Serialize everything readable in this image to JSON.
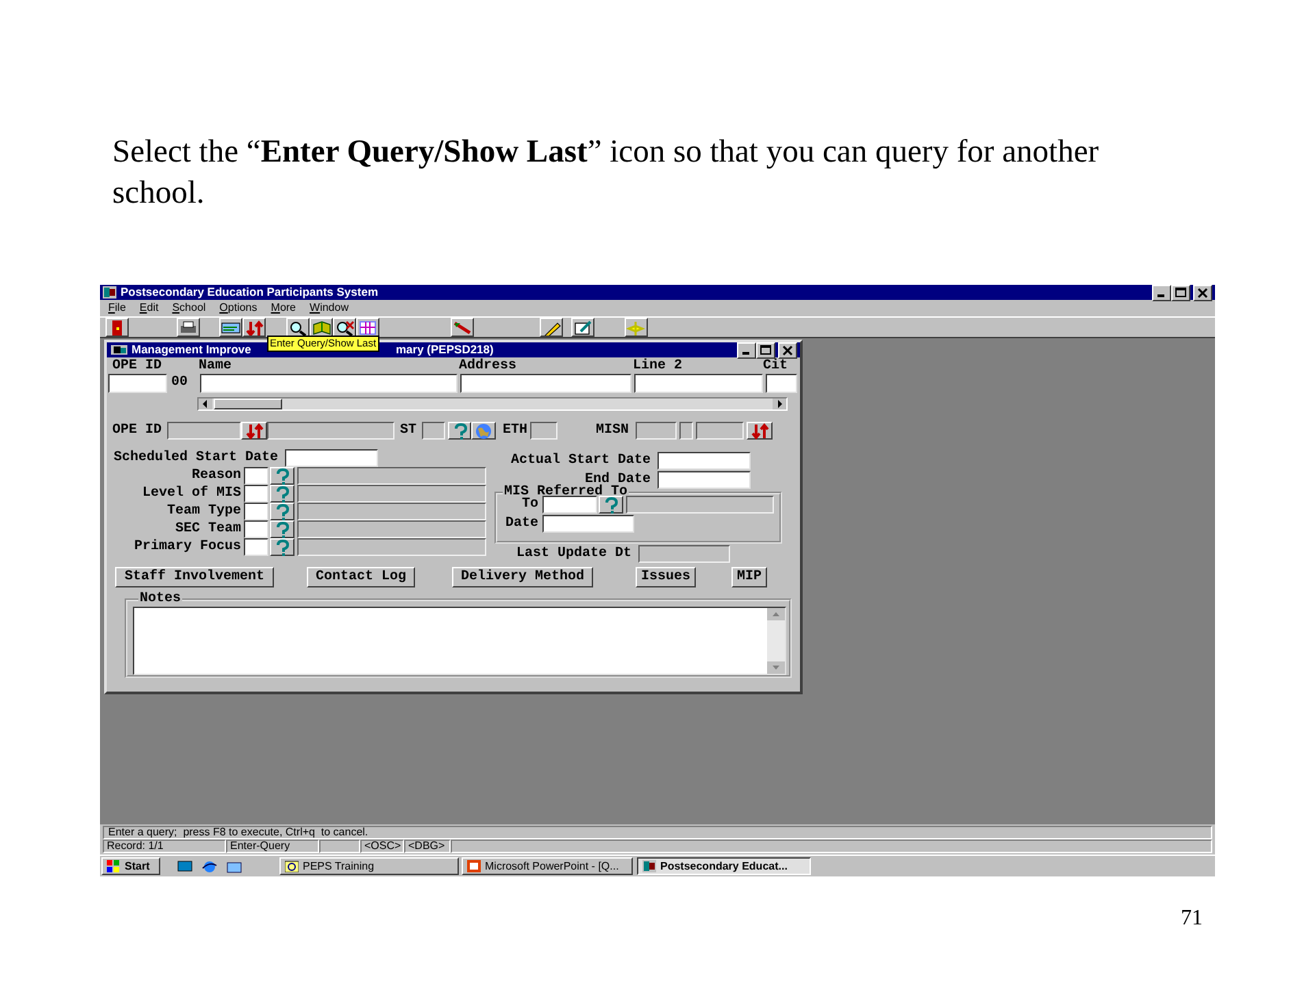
{
  "caption": "Select the “**Enter Query/Show Last**” icon so that you can query for another school.",
  "page_number": "71",
  "app": {
    "title": "Postsecondary Education Participants System",
    "menu": [
      {
        "label": "File"
      },
      {
        "label": "Edit"
      },
      {
        "label": "School"
      },
      {
        "label": "Options"
      },
      {
        "label": "More"
      },
      {
        "label": "Window"
      }
    ],
    "tooltip": "Enter Query/Show Last",
    "form": {
      "title_start": "Management Improve",
      "title_end": "mary (PEPSD218)",
      "ope_id_label": "OPE ID",
      "suffix": "00",
      "columns": [
        "Name",
        "Address",
        "Line 2",
        "Cit"
      ],
      "id_row": {
        "label": "OPE ID",
        "st_label": "ST",
        "eth_label": "ETH",
        "misn_label": "MISN"
      },
      "scheduled_start_label": "Scheduled Start Date",
      "lookups": [
        "Reason",
        "Level of MIS",
        "Team Type",
        "SEC Team",
        "Primary Focus"
      ],
      "actual_start_label": "Actual Start Date",
      "end_date_label": "End Date",
      "referred": {
        "title": "MIS Referred To",
        "to_label": "To",
        "date_label": "Date"
      },
      "last_update_label": "Last Update Dt",
      "buttons": [
        "Staff Involvement",
        "Contact Log",
        "Delivery Method",
        "Issues",
        "MIP"
      ],
      "notes_label": "Notes"
    },
    "status": {
      "message": "Enter a query;  press F8 to execute, Ctrl+q  to cancel.",
      "cells": [
        "Record: 1/1",
        "Enter-Query",
        "<OSC>",
        "<DBG>"
      ]
    },
    "taskbar": {
      "start": "Start",
      "tasks": [
        {
          "label": "PEPS Training",
          "selected": false
        },
        {
          "label": "Microsoft PowerPoint - [Q...",
          "selected": false
        },
        {
          "label": "Postsecondary Educat...",
          "selected": true
        }
      ]
    }
  }
}
